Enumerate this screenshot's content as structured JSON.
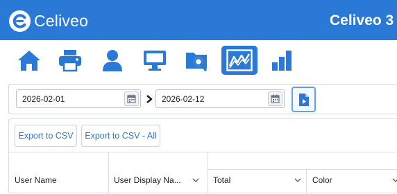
{
  "header": {
    "brand": "Celiveo",
    "title_fragment": "Celiveo 3",
    "background": "#2b79d6"
  },
  "toolbar": {
    "items": [
      {
        "name": "home-icon",
        "active": false
      },
      {
        "name": "printer-icon",
        "active": false
      },
      {
        "name": "user-icon",
        "active": false
      },
      {
        "name": "monitor-icon",
        "active": false
      },
      {
        "name": "folder-search-icon",
        "active": false
      },
      {
        "name": "line-chart-icon",
        "active": true
      },
      {
        "name": "bar-chart-icon",
        "active": false
      }
    ]
  },
  "filters": {
    "start_date": "2026-02-01",
    "end_date": "2026-02-12",
    "range_separator_icon": "chevron-right-icon",
    "calendar_icon": "calendar-icon",
    "run_icon": "play-report-icon"
  },
  "exports": {
    "csv_label": "Export to CSV",
    "csv_all_label": "Export to CSV - All"
  },
  "grid": {
    "columns": [
      "User Name",
      "User Display Na...",
      "Total",
      "Color"
    ]
  }
}
